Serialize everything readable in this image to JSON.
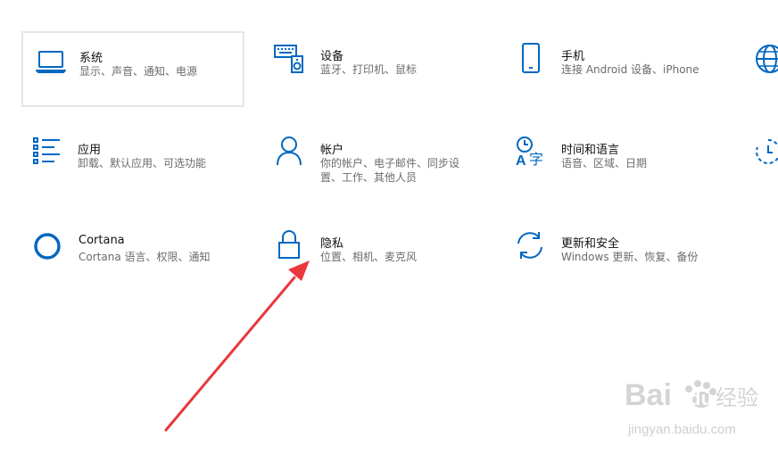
{
  "settings": {
    "tiles": [
      {
        "id": "system",
        "title": "系统",
        "desc": [
          "显示、声音、通知、电源"
        ],
        "icon": "laptop-icon"
      },
      {
        "id": "devices",
        "title": "设备",
        "desc": [
          "蓝牙、打印机、鼠标"
        ],
        "icon": "keyboard-speaker-icon"
      },
      {
        "id": "phone",
        "title": "手机",
        "desc": [
          "连接 Android 设备、iPhone"
        ],
        "icon": "phone-icon"
      },
      {
        "id": "apps",
        "title": "应用",
        "desc": [
          "卸载、默认应用、可选功能"
        ],
        "icon": "apps-list-icon"
      },
      {
        "id": "accounts",
        "title": "帐户",
        "desc": [
          "你的帐户、电子邮件、同步设",
          "置、工作、其他人员"
        ],
        "icon": "person-icon"
      },
      {
        "id": "time-language",
        "title": "时间和语言",
        "desc": [
          "语音、区域、日期"
        ],
        "icon": "time-language-icon"
      },
      {
        "id": "cortana",
        "title": "Cortana",
        "desc": [
          "Cortana 语言、权限、通知"
        ],
        "icon": "cortana-ring-icon"
      },
      {
        "id": "privacy",
        "title": "隐私",
        "desc": [
          "位置、相机、麦克风"
        ],
        "icon": "lock-icon"
      },
      {
        "id": "update-security",
        "title": "更新和安全",
        "desc": [
          "Windows 更新、恢复、备份"
        ],
        "icon": "sync-icon"
      }
    ],
    "partial_icons": [
      "globe-icon",
      "clock-refresh-icon"
    ]
  },
  "colors": {
    "accent": "#0067c0",
    "selected_border": "#e6e6e6",
    "annotation_arrow": "#e8383d",
    "watermark": "#c9c9c9"
  },
  "watermark": {
    "brand": "Bai",
    "brand2": "du",
    "cn": "经验",
    "url": "jingyan.baidu.com"
  }
}
